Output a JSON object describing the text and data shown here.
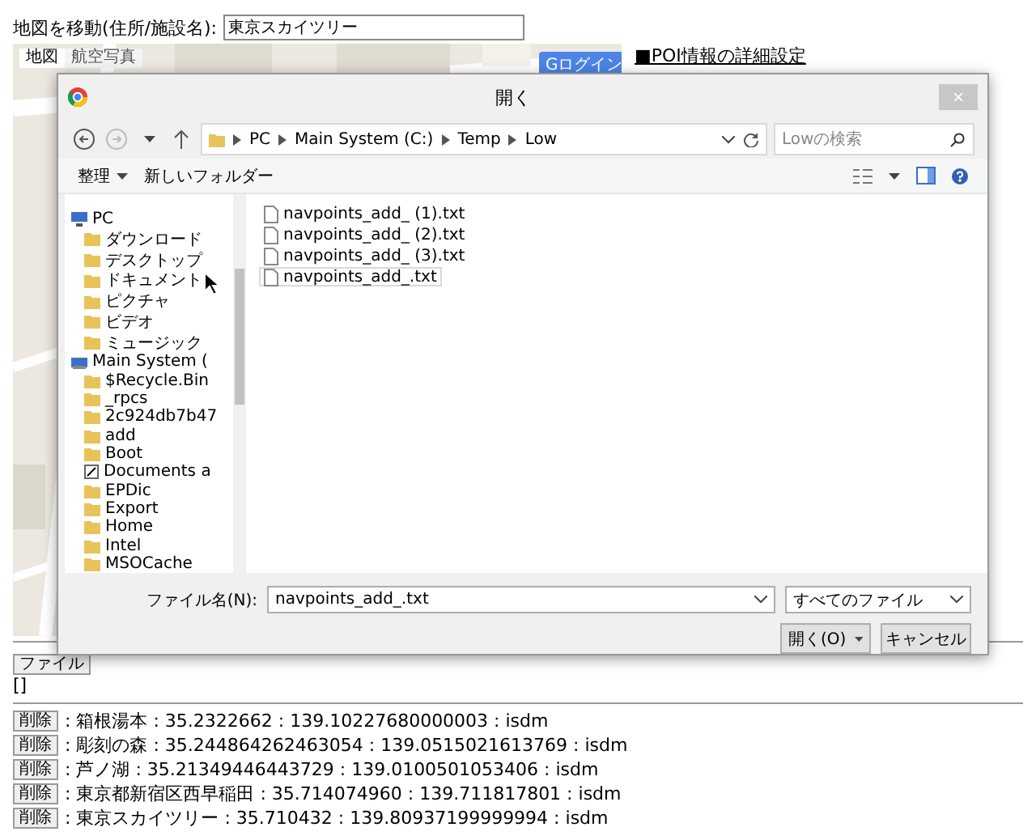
{
  "search": {
    "label": "地図を移動(住所/施設名):",
    "value": "東京スカイツリー"
  },
  "map": {
    "tabs": [
      {
        "label": "地図",
        "selected": true
      },
      {
        "label": "航空写真",
        "selected": false
      }
    ],
    "login": "Gログイン"
  },
  "poi_link": "■POI情報の詳細設定",
  "dialog": {
    "title": "開く",
    "close": "×",
    "breadcrumb": [
      "PC",
      "Main System (C:)",
      "Temp",
      "Low"
    ],
    "search": {
      "placeholder": "Lowの検索"
    },
    "toolbar": [
      {
        "label": "整理",
        "caret": true
      },
      {
        "label": "新しいフォルダー",
        "caret": false
      }
    ],
    "tree": [
      {
        "label": "PC",
        "kind": "computer",
        "children": [
          {
            "label": "ダウンロード",
            "kind": "folder"
          },
          {
            "label": "デスクトップ",
            "kind": "folder"
          },
          {
            "label": "ドキュメント",
            "kind": "folder"
          },
          {
            "label": "ピクチャ",
            "kind": "folder"
          },
          {
            "label": "ビデオ",
            "kind": "folder"
          },
          {
            "label": "ミュージック",
            "kind": "folder"
          }
        ]
      },
      {
        "label": "Main System (",
        "kind": "drive",
        "children": [
          {
            "label": "$Recycle.Bin",
            "kind": "folder"
          },
          {
            "label": "_rpcs",
            "kind": "folder"
          },
          {
            "label": "2c924db7b47",
            "kind": "folder"
          },
          {
            "label": "add",
            "kind": "folder"
          },
          {
            "label": "Boot",
            "kind": "folder"
          },
          {
            "label": "Documents a",
            "kind": "shortcut"
          },
          {
            "label": "EPDic",
            "kind": "folder"
          },
          {
            "label": "Export",
            "kind": "folder"
          },
          {
            "label": "Home",
            "kind": "folder"
          },
          {
            "label": "Intel",
            "kind": "folder"
          },
          {
            "label": "MSOCache",
            "kind": "folder"
          }
        ]
      }
    ],
    "files": [
      {
        "name": "navpoints_add_ (1).txt",
        "selected": false
      },
      {
        "name": "navpoints_add_ (2).txt",
        "selected": false
      },
      {
        "name": "navpoints_add_ (3).txt",
        "selected": false
      },
      {
        "name": "navpoints_add_.txt",
        "selected": true
      }
    ],
    "filename": {
      "label": "ファイル名(N):",
      "value": "navpoints_add_.txt"
    },
    "filter": "すべてのファイル",
    "buttons": [
      {
        "label": "開く(O)",
        "split": true
      },
      {
        "label": "キャンセル",
        "split": false
      }
    ]
  },
  "file_button": "ファイル",
  "result": "[]",
  "points": [
    {
      "button": "削除",
      "text": ": 箱根湯本 : 35.2322662 : 139.10227680000003 : isdm"
    },
    {
      "button": "削除",
      "text": ": 彫刻の森 : 35.244864262463054 : 139.0515021613769 : isdm"
    },
    {
      "button": "削除",
      "text": ": 芦ノ湖 : 35.21349446443729 : 139.0100501053406 : isdm"
    },
    {
      "button": "削除",
      "text": ": 東京都新宿区西早稲田 : 35.714074960 : 139.711817801 : isdm"
    },
    {
      "button": "削除",
      "text": ": 東京スカイツリー : 35.710432 : 139.80937199999994 : isdm"
    }
  ]
}
